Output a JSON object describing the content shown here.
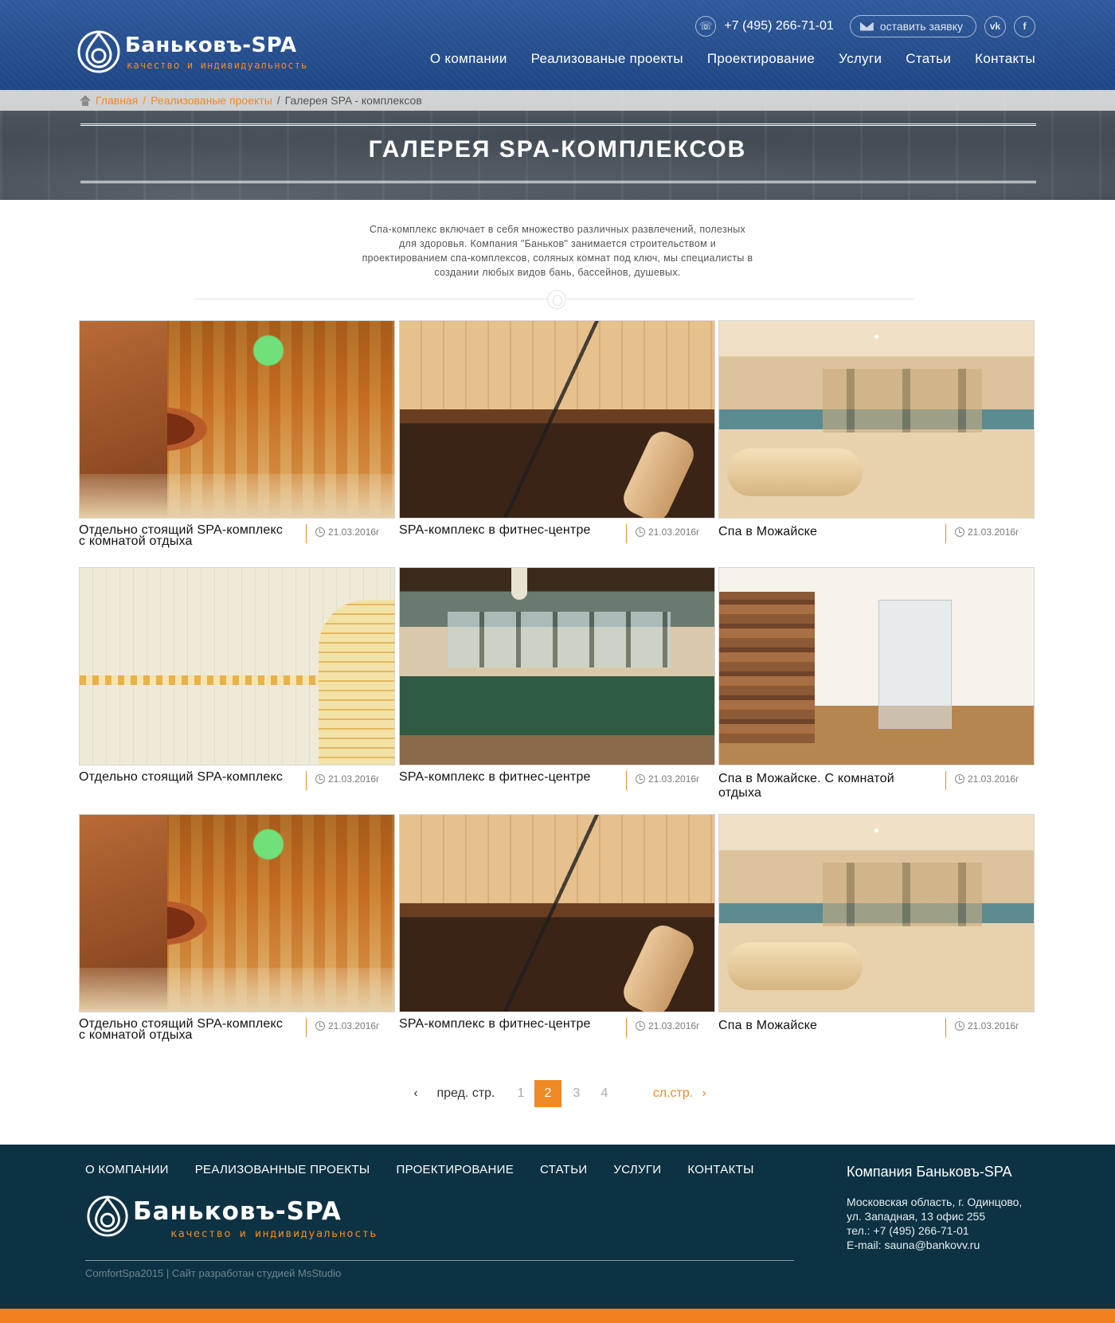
{
  "header": {
    "logo_name": "Баньковъ-SPA",
    "logo_tagline": "качество и индивидуальность",
    "phone": "+7 (495) 266-71-01",
    "request_label": "оставить заявку",
    "social_vk": "vk",
    "social_fb": "f",
    "nav": [
      "О компании",
      "Реализованые проекты",
      "Проектирование",
      "Услуги",
      "Статьи",
      "Контакты"
    ]
  },
  "breadcrumb": {
    "home": "Главная",
    "projects": "Реализованые проекты",
    "current": "Галерея SPA - комплексов",
    "sep": "/"
  },
  "banner_title": "ГАЛЕРЕЯ SPA-КОМПЛЕКСОВ",
  "intro_lines": [
    "Спа-комплекс включает в себя множество различных развлечений, полезных",
    "для здоровья. Компания \"Баньков\" занимается строительством и",
    "проектированием спа-комплексов, соляных комнат под ключ, мы специалисты в",
    "создании любых видов бань, бассейнов, душевых."
  ],
  "gallery": [
    {
      "title_lines": [
        "Отдельно стоящий SPA-комплекс",
        "с комнатой отдыха"
      ],
      "date": "21.03.2016г",
      "art": "salt-cave"
    },
    {
      "title_lines": [
        "SPA-комплекс в фитнес-центре",
        ""
      ],
      "date": "21.03.2016г",
      "art": "sauna"
    },
    {
      "title_lines": [
        "Спа в Можайске",
        ""
      ],
      "date": "21.03.2016г",
      "art": "pool"
    },
    {
      "title_lines": [
        "Отдельно стоящий SPA-комплекс",
        ""
      ],
      "date": "21.03.2016г",
      "art": "hammam"
    },
    {
      "title_lines": [
        "SPA-комплекс в фитнес-центре",
        ""
      ],
      "date": "21.03.2016г",
      "art": "indoor-pool"
    },
    {
      "title_lines": [
        "Спа в Можайске. С комнатой",
        "отдыха"
      ],
      "date": "21.03.2016г",
      "art": "shower"
    },
    {
      "title_lines": [
        "Отдельно стоящий SPA-комплекс",
        "с комнатой отдыха"
      ],
      "date": "21.03.2016г",
      "art": "salt-cave"
    },
    {
      "title_lines": [
        "SPA-комплекс в фитнес-центре",
        ""
      ],
      "date": "21.03.2016г",
      "art": "sauna"
    },
    {
      "title_lines": [
        "Спа в Можайске",
        ""
      ],
      "date": "21.03.2016г",
      "art": "pool"
    }
  ],
  "pagination": {
    "prev_label": "пред. стр.",
    "pages": [
      "1",
      "2",
      "3",
      "4"
    ],
    "active": "2",
    "next_label": "сл.стр."
  },
  "footer": {
    "nav": [
      "О КОМПАНИИ",
      "РЕАЛИЗОВАННЫЕ ПРОЕКТЫ",
      "ПРОЕКТИРОВАНИЕ",
      "СТАТЬИ",
      "УСЛУГИ",
      "КОНТАКТЫ"
    ],
    "logo_name": "Баньковъ-SPA",
    "logo_tagline": "качество и индивидуальность",
    "copyright": "ComfortSpa2015 | Сайт разработан студией ",
    "studio": "MsStudio",
    "company_title": "Компания Баньковъ-SPA",
    "address_1": "Московская область, г. Одинцово,",
    "address_2": "ул. Западная, 13 офис 255",
    "phone": "тел.: +7 (495) 266-71-01",
    "email": "E-mail: sauna@bankovv.ru"
  },
  "colors": {
    "header_blue": "#2f5a9c",
    "accent_orange": "#f08a24",
    "footer_dark": "#0d3243"
  }
}
